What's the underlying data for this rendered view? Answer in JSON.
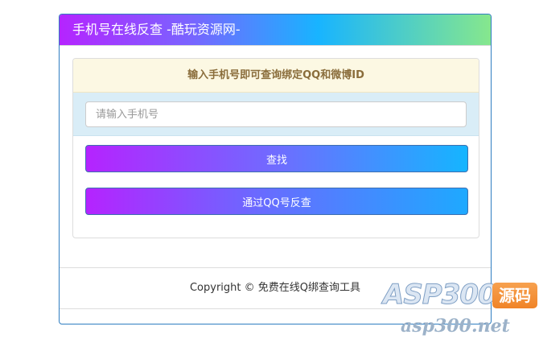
{
  "header": {
    "title": "手机号在线反查 -酷玩资源网-"
  },
  "notice": {
    "text": "输入手机号即可查询绑定QQ和微博ID"
  },
  "search": {
    "placeholder": "请输入手机号",
    "value": ""
  },
  "buttons": {
    "search_label": "查找",
    "qq_reverse_label": "通过QQ号反查"
  },
  "footer": {
    "copyright": "Copyright © 免费在线Q绑查询工具"
  },
  "watermark": {
    "main": "ASP300",
    "badge": "源码",
    "url": "asp300.net"
  },
  "colors": {
    "panel_border": "#2f7dc1",
    "notice_bg": "#fcf8e3",
    "notice_text": "#8a6d3b",
    "input_row_bg": "#d9edf7"
  }
}
